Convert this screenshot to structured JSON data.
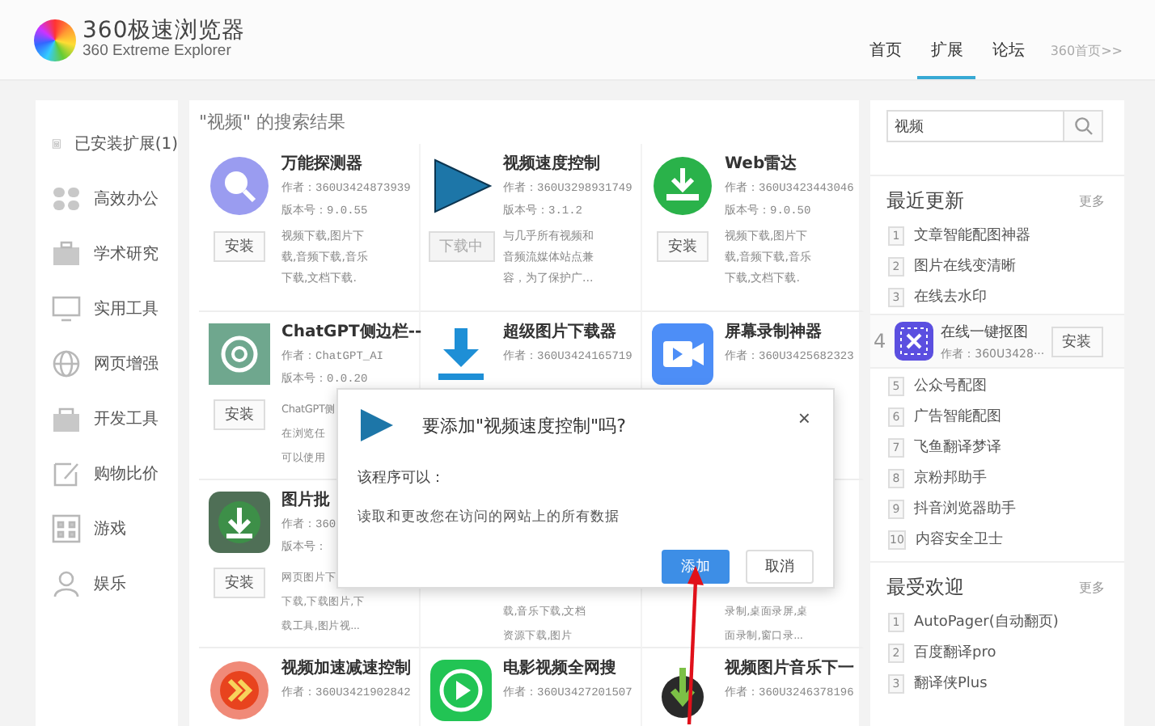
{
  "header": {
    "title": "360极速浏览器",
    "subtitle": "360 Extreme Explorer",
    "nav": [
      {
        "label": "首页",
        "selected": false
      },
      {
        "label": "扩展",
        "selected": true
      },
      {
        "label": "论坛",
        "selected": false
      }
    ],
    "home_link": "360首页>>"
  },
  "sidebar": {
    "items": [
      {
        "label": "已安装扩展(1)"
      },
      {
        "label": "高效办公"
      },
      {
        "label": "学术研究"
      },
      {
        "label": "实用工具"
      },
      {
        "label": "网页增强"
      },
      {
        "label": "开发工具"
      },
      {
        "label": "购物比价"
      },
      {
        "label": "游戏"
      },
      {
        "label": "娱乐"
      }
    ]
  },
  "results_title": "\"视频\" 的搜索结果",
  "cards": [
    {
      "name": "万能探测器",
      "author": "作者：360U3424873939",
      "version": "版本号：9.0.55",
      "button": {
        "label": "安装",
        "disabled": false
      },
      "desc": "视频下载,图片下载,音频下载,音乐下载,文档下载."
    },
    {
      "name": "视频速度控制",
      "author": "作者：360U3298931749",
      "version": "版本号：3.1.2",
      "button": {
        "label": "下载中",
        "disabled": true
      },
      "desc": "与几乎所有视频和音频流媒体站点兼容，为了保护广..."
    },
    {
      "name": "Web雷达",
      "author": "作者：360U3423443046",
      "version": "版本号：9.0.50",
      "button": {
        "label": "安装",
        "disabled": false
      },
      "desc": "视频下载,图片下载,音频下载,音乐下载,文档下载."
    },
    {
      "name": "ChatGPT侧边栏--",
      "author": "作者：ChatGPT_AI",
      "version": "版本号：0.0.20",
      "button": {
        "label": "安装",
        "disabled": false
      },
      "desc_fragments": [
        "ChatGPT侧",
        "在浏览任",
        "可以使用"
      ]
    },
    {
      "name": "超级图片下载器",
      "author": "作者：360U3424165719"
    },
    {
      "name": "屏幕录制神器",
      "author": "作者：360U3425682323"
    },
    {
      "name": "图片批",
      "author": "作者：360",
      "version": "版本号：",
      "button": {
        "label": "安装",
        "disabled": false
      },
      "desc_fragments": [
        "网页图片下",
        "下载,下载图片,下",
        "载工具,图片视..."
      ]
    },
    {
      "desc_fragments": [
        "载,音乐下载,文档",
        "资源下载,图片"
      ]
    },
    {
      "desc_fragments": [
        "录制,桌面录屏,桌",
        "面录制,窗口录..."
      ]
    },
    {
      "name": "视频加速减速控制",
      "author": "作者：360U3421902842"
    },
    {
      "name": "电影视频全网搜",
      "author": "作者：360U3427201507"
    },
    {
      "name": "视频图片音乐下一",
      "author": "作者：360U3246378196"
    }
  ],
  "dialog": {
    "title": "要添加\"视频速度控制\"吗?",
    "close": "×",
    "subtitle": "该程序可以：",
    "permission": "读取和更改您在访问的网站上的所有数据",
    "buttons": [
      {
        "label": "添加",
        "primary": true
      },
      {
        "label": "取消",
        "primary": false
      }
    ]
  },
  "right": {
    "search": {
      "value": "视频"
    },
    "sections": [
      {
        "title": "最近更新",
        "more": "更多",
        "items": [
          {
            "kind": "plain",
            "rank": "1",
            "name": "文章智能配图神器"
          },
          {
            "kind": "plain",
            "rank": "2",
            "name": "图片在线变清晰"
          },
          {
            "kind": "plain",
            "rank": "3",
            "name": "在线去水印"
          },
          {
            "kind": "expanded",
            "rank": "4",
            "name": "在线一键抠图",
            "author": "作者：360U3428···",
            "button": "安装"
          },
          {
            "kind": "plain",
            "rank": "5",
            "name": "公众号配图"
          },
          {
            "kind": "plain",
            "rank": "6",
            "name": "广告智能配图"
          },
          {
            "kind": "plain",
            "rank": "7",
            "name": "飞鱼翻译梦译"
          },
          {
            "kind": "plain",
            "rank": "8",
            "name": "京粉邦助手"
          },
          {
            "kind": "plain",
            "rank": "9",
            "name": "抖音浏览器助手"
          },
          {
            "kind": "plain",
            "rank": "10",
            "name": "内容安全卫士"
          }
        ]
      },
      {
        "title": "最受欢迎",
        "more": "更多",
        "items": [
          {
            "kind": "plain",
            "rank": "1",
            "name": "AutoPager(自动翻页)"
          },
          {
            "kind": "plain",
            "rank": "2",
            "name": "百度翻译pro"
          },
          {
            "kind": "plain",
            "rank": "3",
            "name": "翻译侠Plus"
          }
        ]
      }
    ]
  }
}
